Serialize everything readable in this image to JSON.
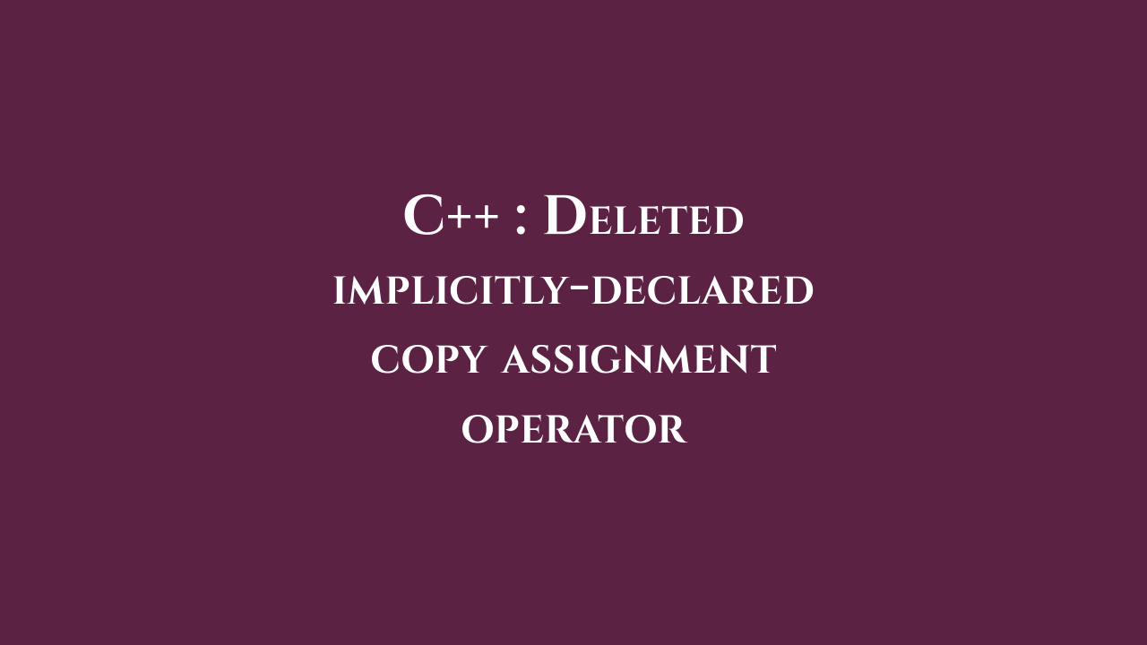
{
  "title": {
    "line1": "C++ : Deleted",
    "line2": "implicitly-declared",
    "line3": "copy assignment",
    "line4": "operator"
  }
}
